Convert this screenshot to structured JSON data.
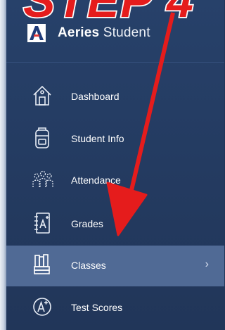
{
  "brand": {
    "bold": "Aeries",
    "regular": "Student"
  },
  "annotation_text": "STEP 4",
  "nav": {
    "items": [
      {
        "label": "Dashboard",
        "icon": "house-icon"
      },
      {
        "label": "Student Info",
        "icon": "backpack-icon"
      },
      {
        "label": "Attendance",
        "icon": "people-icon"
      },
      {
        "label": "Grades",
        "icon": "notebook-grade-icon"
      },
      {
        "label": "Classes",
        "icon": "books-icon",
        "active": true,
        "chevron": "›"
      },
      {
        "label": "Test Scores",
        "icon": "a-plus-icon"
      }
    ]
  },
  "colors": {
    "sidebar_bg": "#243b61",
    "active_bg": "#506a95",
    "annotation_red": "#e51c1c"
  }
}
